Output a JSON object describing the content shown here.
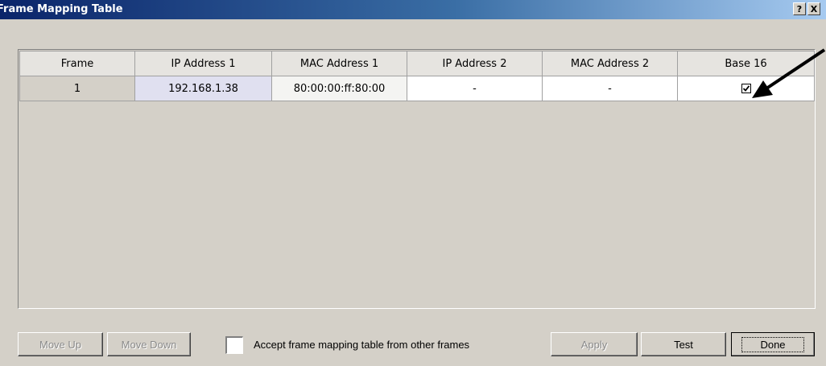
{
  "window": {
    "title": "Frame Mapping Table",
    "help_label": "?",
    "close_label": "X"
  },
  "table": {
    "headers": [
      "Frame",
      "IP Address 1",
      "MAC Address 1",
      "IP Address 2",
      "MAC Address 2",
      "Base 16"
    ],
    "rows": [
      {
        "frame": "1",
        "ip1": "192.168.1.38",
        "mac1": "80:00:00:ff:80:00",
        "ip2": "-",
        "mac2": "-",
        "base16_checked": true
      }
    ]
  },
  "buttons": {
    "move_up": "Move Up",
    "move_down": "Move Down",
    "apply": "Apply",
    "test": "Test",
    "done": "Done"
  },
  "options": {
    "accept_label": "Accept frame mapping table from other frames",
    "accept_checked": false
  },
  "colors": {
    "titlebar_start": "#0a246a",
    "titlebar_end": "#a6caf0",
    "face": "#d4d0c8"
  }
}
